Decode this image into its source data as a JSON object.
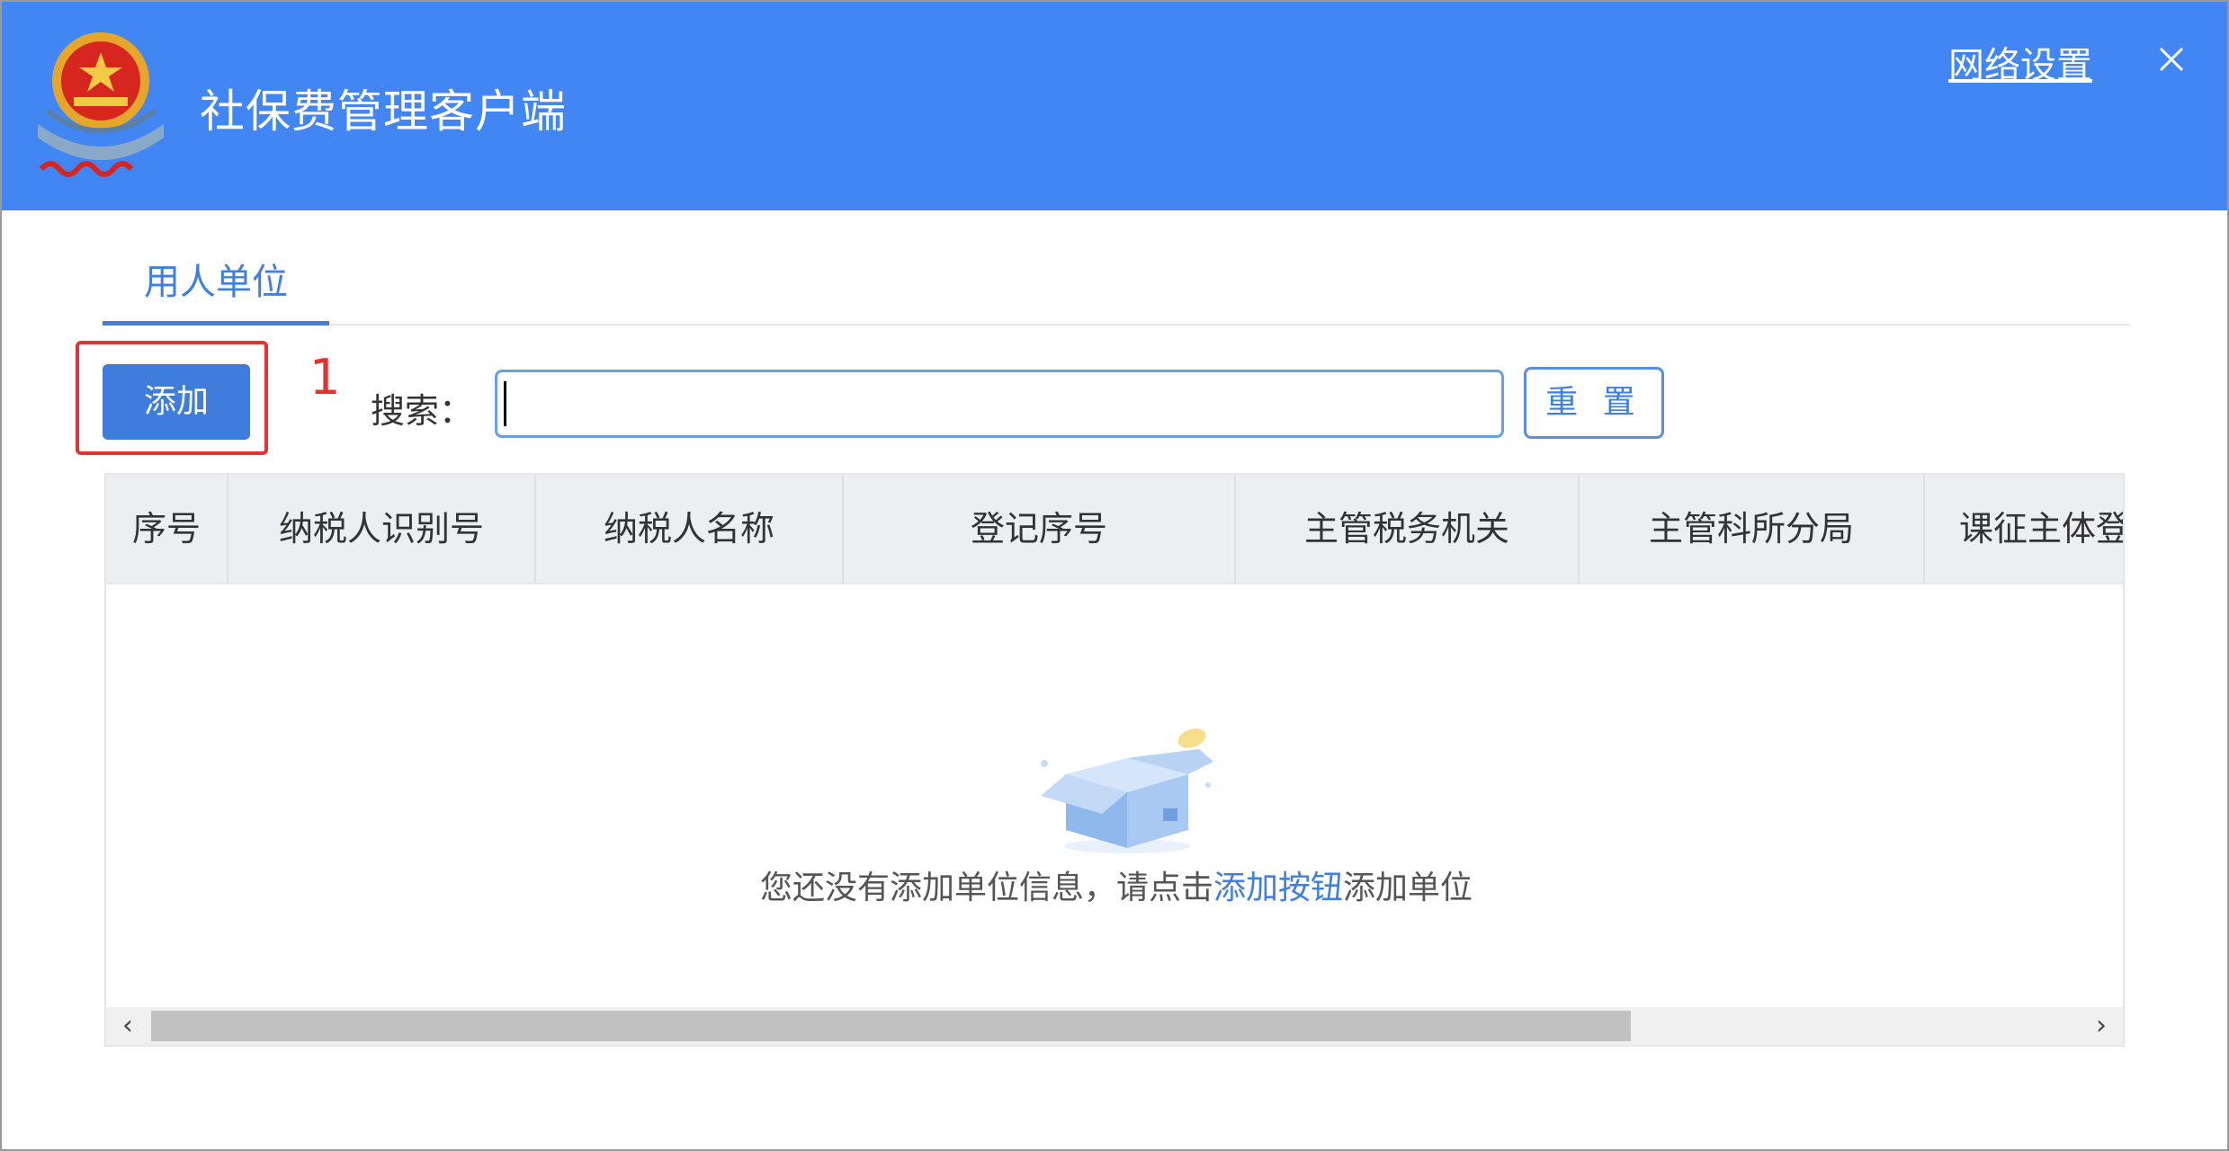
{
  "app": {
    "title": "社保费管理客户端",
    "network_settings_label": "网络设置",
    "close_icon": "close-icon",
    "emblem_icon": "tax-emblem-icon",
    "accent_color": "#4286f4"
  },
  "tabs": [
    {
      "label": "用人单位",
      "active": true
    }
  ],
  "toolbar": {
    "add_label": "添加",
    "annotation_number": "1",
    "search_label": "搜索：",
    "search_value": "",
    "reset_label": "重 置"
  },
  "table": {
    "columns": [
      "序号",
      "纳税人识别号",
      "纳税人名称",
      "登记序号",
      "主管税务机关",
      "主管科所分局",
      "课征主体登"
    ],
    "rows": [],
    "empty_text_prefix": "您还没有添加单位信息，请点击",
    "empty_text_link": "添加按钮",
    "empty_text_suffix": "添加单位"
  }
}
